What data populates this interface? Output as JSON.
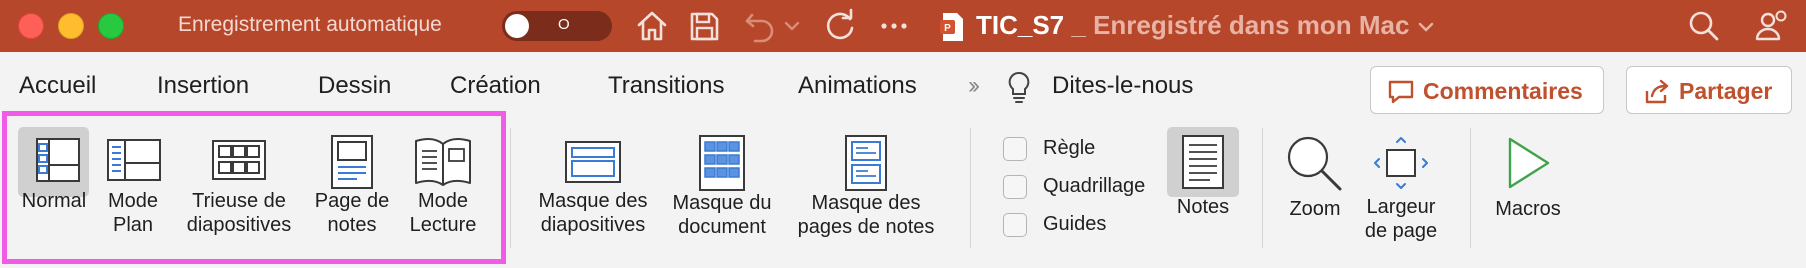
{
  "titlebar": {
    "autosave_label": "Enregistrement automatique",
    "autosave_state": "O",
    "doc_name": "TIC_S7",
    "doc_status": " _ Enregistré dans mon Mac",
    "icons": [
      "home-icon",
      "save-icon",
      "undo-icon",
      "undo-dropdown-icon",
      "redo-icon",
      "more-icon",
      "search-icon",
      "share-people-icon"
    ]
  },
  "tabs": {
    "items": [
      "Accueil",
      "Insertion",
      "Dessin",
      "Création",
      "Transitions",
      "Animations"
    ],
    "tell_me": "Dites-le-nous",
    "comments": "Commentaires",
    "share": "Partager"
  },
  "ribbon": {
    "views": [
      {
        "line1": "Normal",
        "line2": ""
      },
      {
        "line1": "Mode",
        "line2": "Plan"
      },
      {
        "line1": "Trieuse de",
        "line2": "diapositives"
      },
      {
        "line1": "Page de",
        "line2": "notes"
      },
      {
        "line1": "Mode",
        "line2": "Lecture"
      }
    ],
    "masters": [
      {
        "line1": "Masque des",
        "line2": "diapositives"
      },
      {
        "line1": "Masque du",
        "line2": "document"
      },
      {
        "line1": "Masque des",
        "line2": "pages de notes"
      }
    ],
    "show": [
      "Règle",
      "Quadrillage",
      "Guides"
    ],
    "notes": "Notes",
    "zoom": "Zoom",
    "fit": {
      "line1": "Largeur",
      "line2": "de page"
    },
    "macros": "Macros"
  },
  "colors": {
    "titlebar": "#b7472a",
    "accent": "#c0502e",
    "highlight": "#f25ae8",
    "icon_blue": "#3a7bd5"
  }
}
